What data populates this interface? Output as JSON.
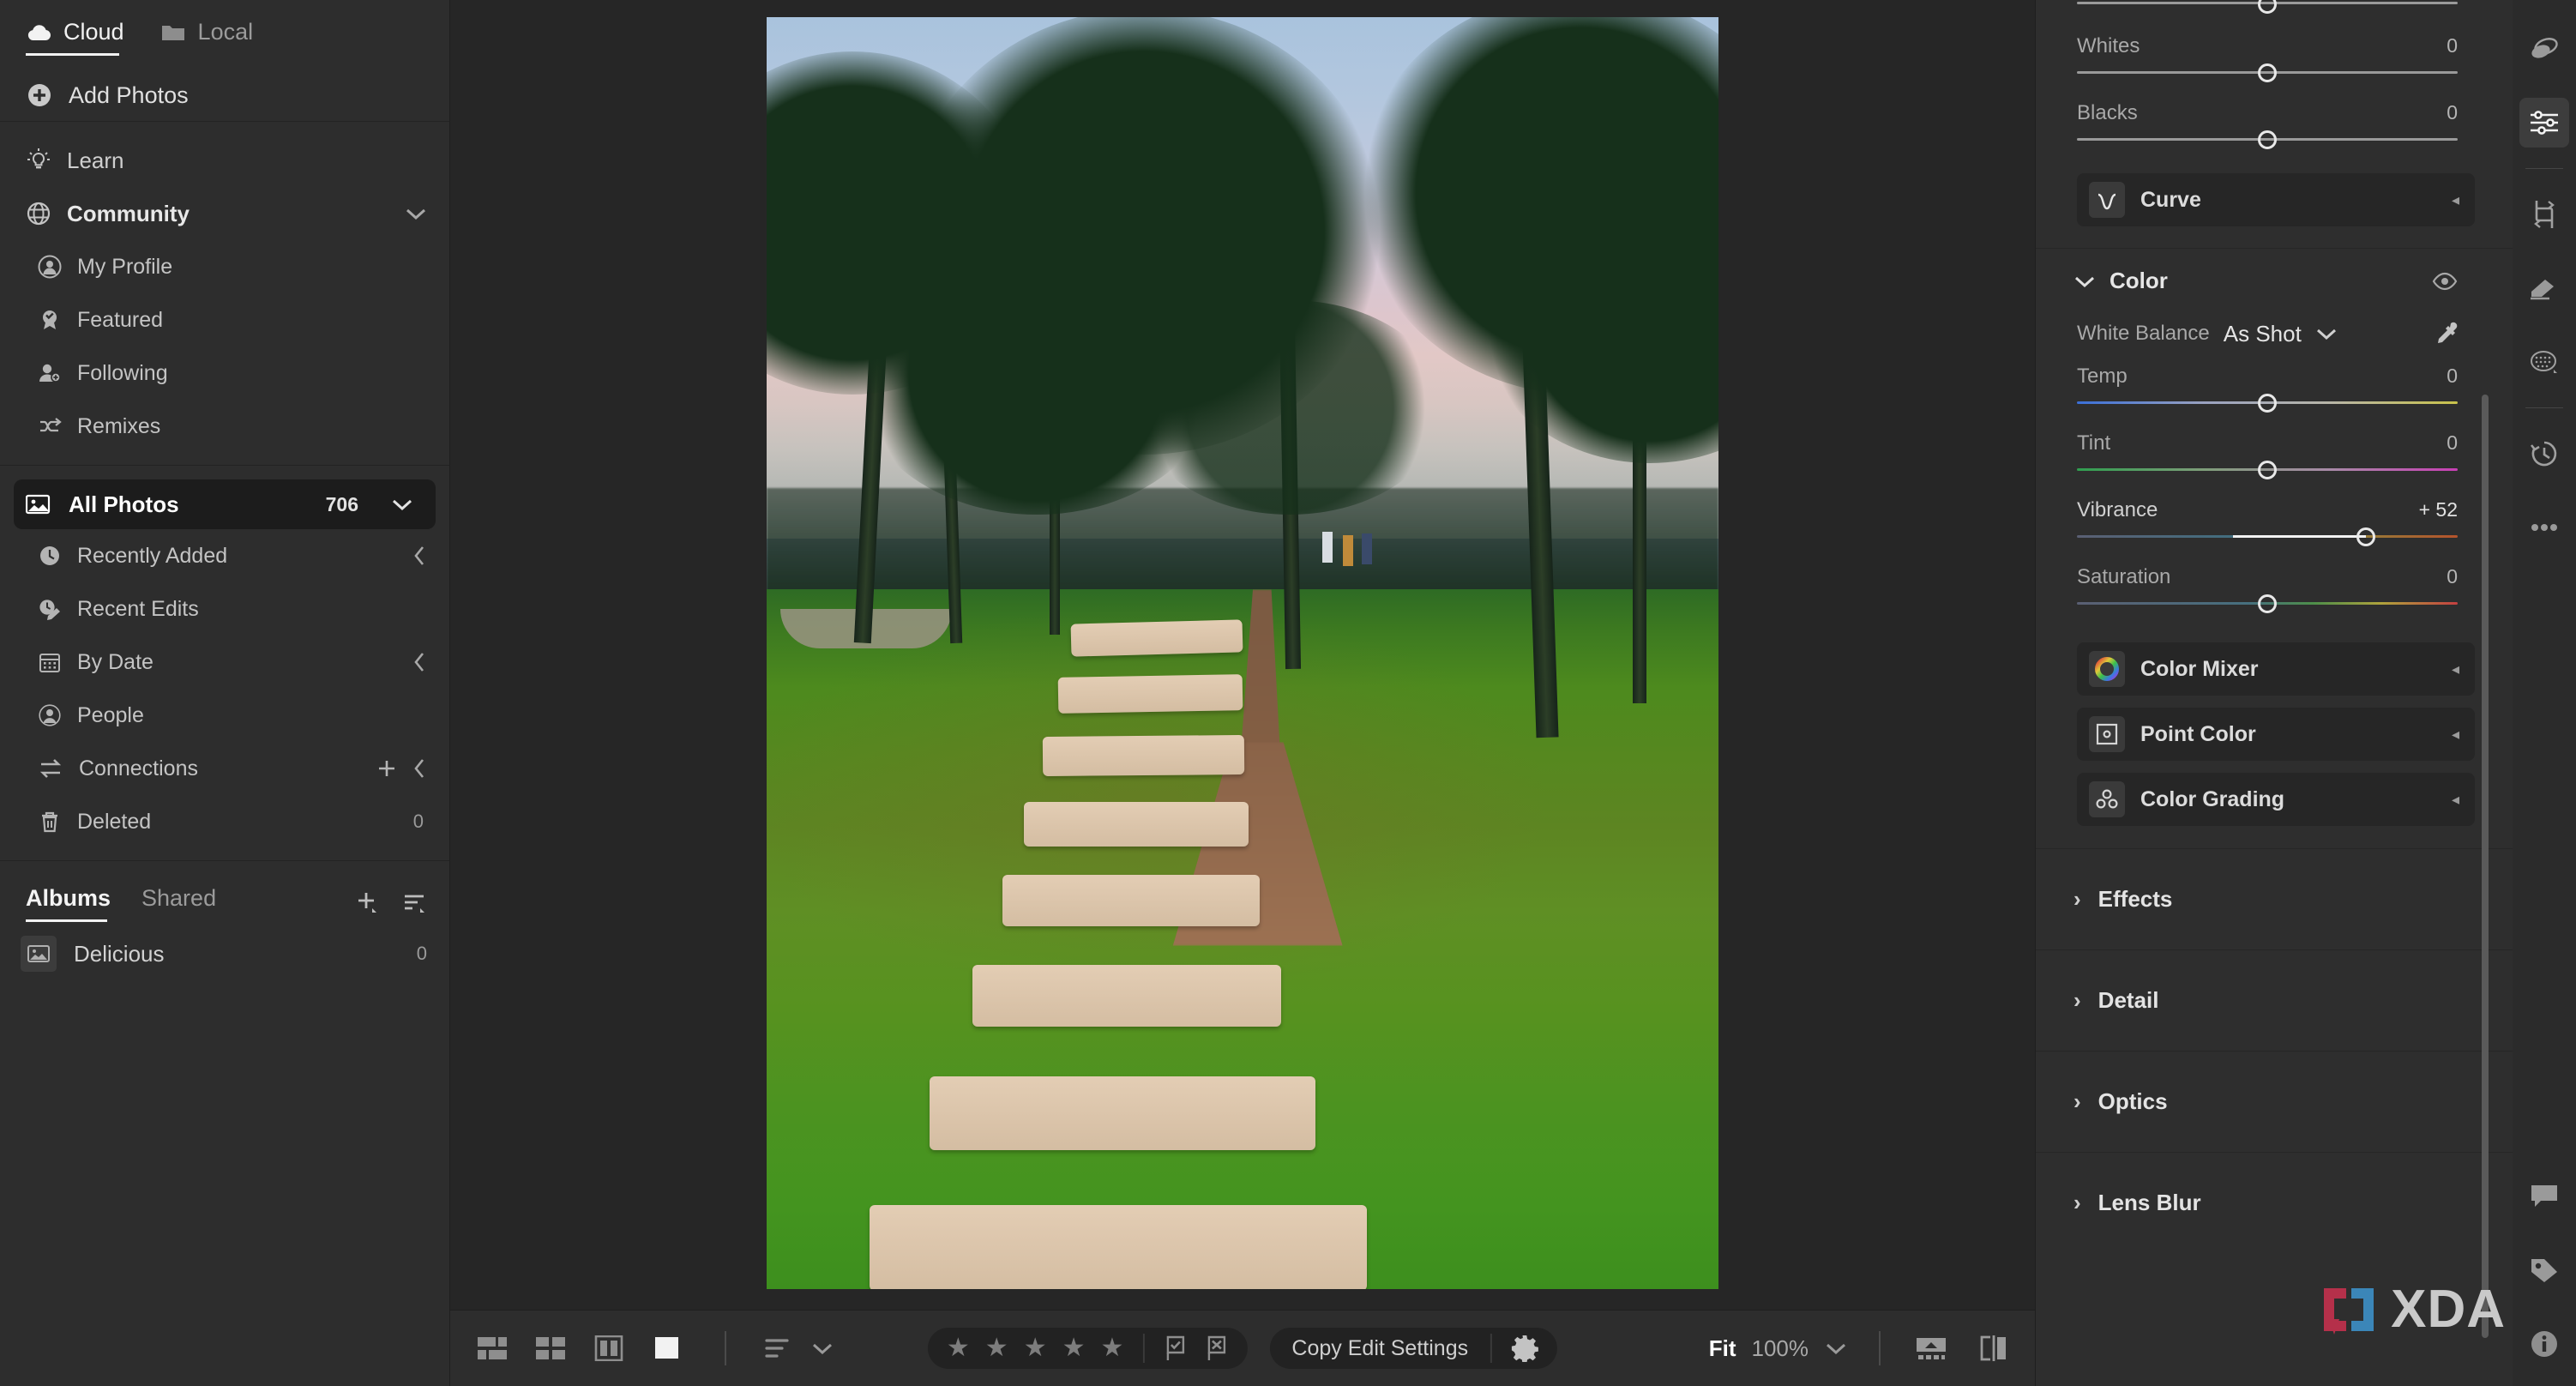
{
  "sidebar": {
    "source_tabs": [
      {
        "label": "Cloud",
        "icon": "cloud-icon",
        "active": true
      },
      {
        "label": "Local",
        "icon": "folder-icon",
        "active": false
      }
    ],
    "add_photos": {
      "label": "Add Photos",
      "icon": "plus-circle-icon"
    },
    "nav": [
      {
        "label": "Learn",
        "icon": "lightbulb-icon"
      },
      {
        "label": "Community",
        "icon": "globe-icon",
        "bold": true,
        "chevron": "chevron-down"
      }
    ],
    "community_children": [
      {
        "label": "My Profile",
        "icon": "user-circle-icon"
      },
      {
        "label": "Featured",
        "icon": "award-icon"
      },
      {
        "label": "Following",
        "icon": "user-plus-icon"
      },
      {
        "label": "Remixes",
        "icon": "remix-icon"
      }
    ],
    "library": {
      "all_photos": {
        "label": "All Photos",
        "count": "706",
        "icon": "photo-icon"
      },
      "items": [
        {
          "label": "Recently Added",
          "icon": "clock-icon",
          "count": "",
          "chevron": "chevron-left"
        },
        {
          "label": "Recent Edits",
          "icon": "clock-edit-icon",
          "count": "",
          "chevron": ""
        },
        {
          "label": "By Date",
          "icon": "calendar-icon",
          "count": "",
          "chevron": "chevron-left"
        },
        {
          "label": "People",
          "icon": "person-icon",
          "count": "",
          "chevron": ""
        },
        {
          "label": "Connections",
          "icon": "connections-icon",
          "count": "",
          "chevron": "chevron-left",
          "plus": true
        },
        {
          "label": "Deleted",
          "icon": "trash-icon",
          "count": "0",
          "chevron": ""
        }
      ]
    },
    "albums": {
      "tabs": [
        {
          "label": "Albums",
          "active": true
        },
        {
          "label": "Shared",
          "active": false
        }
      ],
      "actions": [
        "add-album-icon",
        "sort-albums-icon"
      ],
      "items": [
        {
          "label": "Delicious",
          "count": "0",
          "icon": "album-thumb-icon"
        }
      ]
    }
  },
  "bottombar": {
    "view_modes": [
      {
        "name": "grid-compact-view-icon"
      },
      {
        "name": "grid-square-view-icon"
      },
      {
        "name": "compare-view-icon"
      },
      {
        "name": "single-photo-view-icon",
        "active": true
      }
    ],
    "sort": {
      "icon": "sort-icon",
      "chevron": "chevron-down-icon"
    },
    "rating": {
      "stars": 5,
      "filled": 0,
      "glyph": "★"
    },
    "flags": [
      "flag-pick-icon",
      "flag-reject-icon"
    ],
    "copy_edit_settings": {
      "label": "Copy Edit Settings",
      "gear": "gear-icon"
    },
    "zoom": {
      "fit_label": "Fit",
      "percent": "100%",
      "chevron": "chevron-down-icon"
    },
    "right_icons": [
      "filmstrip-toggle-icon",
      "before-after-icon"
    ]
  },
  "rightpanel": {
    "light_tail": {
      "partial_slider_value": "",
      "sliders": [
        {
          "label": "Whites",
          "value": "0",
          "pos": 50
        },
        {
          "label": "Blacks",
          "value": "0",
          "pos": 50
        }
      ]
    },
    "curve": {
      "label": "Curve",
      "icon": "curve-icon",
      "arrow": "◂"
    },
    "color": {
      "title": "Color",
      "collapse_icon": "chevron-down-icon",
      "visibility_icon": "eye-icon",
      "white_balance": {
        "label": "White Balance",
        "value": "As Shot",
        "chevron": "chevron-down-icon",
        "eyedropper": "eyedropper-icon"
      },
      "sliders": [
        {
          "label": "Temp",
          "value": "0",
          "pos": 50,
          "gradient": "temp"
        },
        {
          "label": "Tint",
          "value": "0",
          "pos": 50,
          "gradient": "tint"
        },
        {
          "label": "Vibrance",
          "value": "+ 52",
          "pos": 76,
          "gradient": "vibrance"
        },
        {
          "label": "Saturation",
          "value": "0",
          "pos": 50,
          "gradient": "saturation"
        }
      ],
      "sub_panels": [
        {
          "label": "Color Mixer",
          "icon": "color-wheel-icon",
          "arrow": "◂"
        },
        {
          "label": "Point Color",
          "icon": "point-color-icon",
          "arrow": "◂"
        },
        {
          "label": "Color Grading",
          "icon": "color-grading-icon",
          "arrow": "◂"
        }
      ]
    },
    "collapsed_sections": [
      {
        "label": "Effects",
        "chevron": "›"
      },
      {
        "label": "Detail",
        "chevron": "›"
      },
      {
        "label": "Optics",
        "chevron": "›"
      },
      {
        "label": "Lens Blur",
        "chevron": "›"
      }
    ]
  },
  "toolrail": {
    "top": [
      {
        "name": "presets-icon",
        "active": false
      },
      {
        "name": "edit-sliders-icon",
        "active": true
      }
    ],
    "middle": [
      {
        "name": "crop-icon"
      },
      {
        "name": "healing-brush-icon"
      },
      {
        "name": "masking-icon"
      }
    ],
    "bottom": [
      {
        "name": "versions-history-icon"
      },
      {
        "name": "more-options-icon"
      }
    ],
    "footer": [
      {
        "name": "comments-icon"
      },
      {
        "name": "keywords-tag-icon"
      },
      {
        "name": "info-icon"
      }
    ]
  },
  "watermark": {
    "text": "XDA",
    "bracket_left_color": "#b5304a",
    "bracket_right_color": "#3b86b8"
  },
  "colors": {
    "panel_bg": "#2d2d2d",
    "canvas_bg": "#262626",
    "accent_white": "#f2f2f2",
    "muted_text": "#9b9b9b"
  }
}
